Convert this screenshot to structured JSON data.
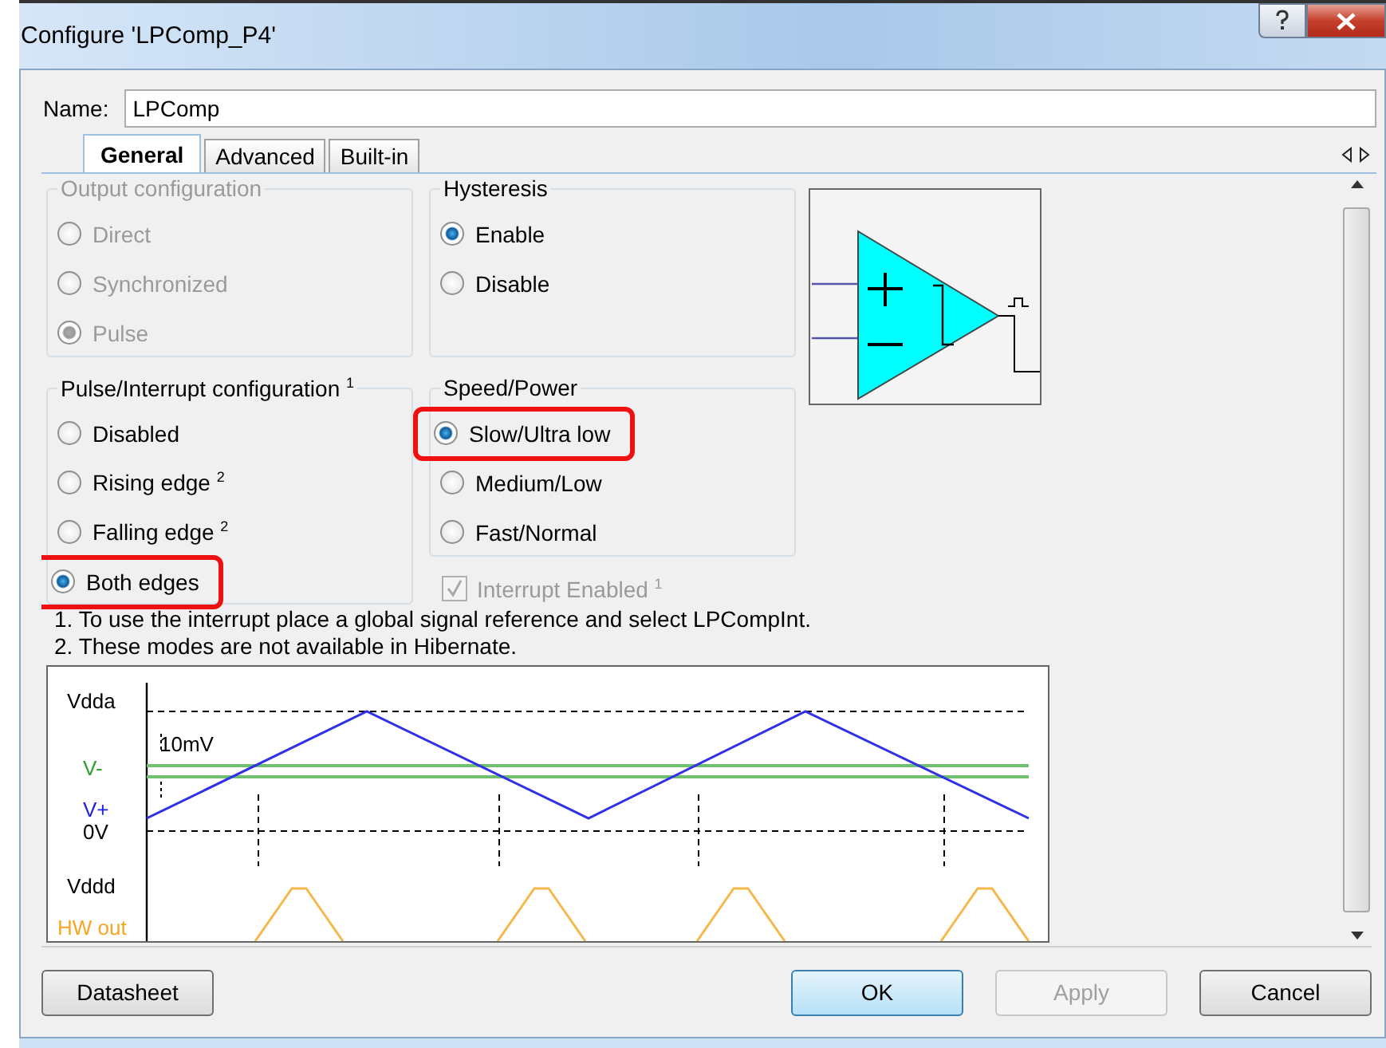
{
  "window": {
    "title": "Configure 'LPComp_P4'"
  },
  "name_field": {
    "label": "Name:",
    "value": "LPComp"
  },
  "tabs": [
    {
      "label": "General",
      "selected": true
    },
    {
      "label": "Advanced",
      "selected": false
    },
    {
      "label": "Built-in",
      "selected": false
    }
  ],
  "groups": [
    {
      "title": "Output configuration",
      "disabled": true,
      "options": [
        {
          "label": "Direct",
          "selected": false,
          "highlighted": false
        },
        {
          "label": "Synchronized",
          "selected": false,
          "highlighted": false
        },
        {
          "label": "Pulse",
          "selected": true,
          "highlighted": false
        }
      ]
    },
    {
      "title": "Hysteresis",
      "disabled": false,
      "options": [
        {
          "label": "Enable",
          "selected": true,
          "highlighted": false
        },
        {
          "label": "Disable",
          "selected": false,
          "highlighted": false
        }
      ]
    },
    {
      "title": "Pulse/Interrupt configuration $^{1}$",
      "disabled": false,
      "options": [
        {
          "label": "Disabled",
          "selected": false,
          "highlighted": false
        },
        {
          "label": "Rising edge $^{2}$",
          "selected": false,
          "highlighted": false
        },
        {
          "label": "Falling edge $^{2}$",
          "selected": false,
          "highlighted": false
        },
        {
          "label": "Both edges",
          "selected": true,
          "highlighted": true
        }
      ]
    },
    {
      "title": "Speed/Power",
      "disabled": false,
      "options": [
        {
          "label": "Slow/Ultra low",
          "selected": true,
          "highlighted": true
        },
        {
          "label": "Medium/Low",
          "selected": false,
          "highlighted": false
        },
        {
          "label": "Fast/Normal",
          "selected": false,
          "highlighted": false
        }
      ]
    }
  ],
  "interrupt_checkbox": {
    "label": "Interrupt Enabled $^{1}$",
    "checked": true,
    "disabled": true
  },
  "notes": [
    "1. To use the interrupt place a global signal reference and select LPCompInt.",
    "2. These modes are not available in Hibernate."
  ],
  "waveform": {
    "labels": [
      {
        "text": "Vdda",
        "color": "#000000"
      },
      {
        "text": "10mV",
        "color": "#000000"
      },
      {
        "text": "V-",
        "color": "#2ca02c"
      },
      {
        "text": "V+",
        "color": "#2020e0"
      },
      {
        "text": "0V",
        "color": "#000000"
      },
      {
        "text": "Vddd",
        "color": "#000000"
      },
      {
        "text": "HW out",
        "color": "#f5a623"
      }
    ]
  },
  "buttons": [
    {
      "label": "Datasheet",
      "default": false,
      "disabled": false
    },
    {
      "label": "OK",
      "default": true,
      "disabled": false
    },
    {
      "label": "Apply",
      "default": false,
      "disabled": true
    },
    {
      "label": "Cancel",
      "default": false,
      "disabled": false
    }
  ]
}
